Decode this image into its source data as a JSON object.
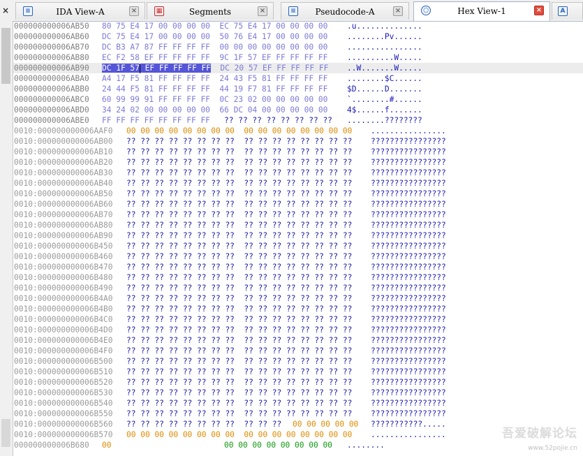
{
  "tabs": [
    {
      "label": "IDA View-A",
      "icon": "listing-icon",
      "active": false
    },
    {
      "label": "Segments",
      "icon": "segments-icon",
      "active": false
    },
    {
      "label": "Pseudocode-A",
      "icon": "pseudocode-icon",
      "active": false
    },
    {
      "label": "Hex View-1",
      "icon": "hex-view-icon",
      "active": true
    },
    {
      "label": "",
      "icon": "structures-icon",
      "active": false
    }
  ],
  "loaded_rows": [
    {
      "addr": "000000000006AB50",
      "bytes": "80 75 E4 17 00 00 00 00  EC 75 E4 17 00 00 00 00",
      "ascii": ".u.............."
    },
    {
      "addr": "000000000006AB60",
      "bytes": "DC 75 E4 17 00 00 00 00  50 76 E4 17 00 00 00 00",
      "ascii": "........Pv......"
    },
    {
      "addr": "000000000006AB70",
      "bytes": "DC B3 A7 87 FF FF FF FF  00 00 00 00 00 00 00 00",
      "ascii": "................"
    },
    {
      "addr": "000000000006AB80",
      "bytes": "EC F2 58 EF FF FF FF FF  9C 1F 57 EF FF FF FF FF",
      "ascii": "..........W....."
    },
    {
      "addr": "000000000006AB90",
      "bytes_pre": "DC 1F 57",
      "bytes_post": " EF FF FF FF FF  DC 20 57 EF FF FF FF FF",
      "ascii": "..W.......W.....",
      "highlight": true
    },
    {
      "addr": "000000000006ABA0",
      "bytes": "A4 17 F5 81 FF FF FF FF  24 43 F5 81 FF FF FF FF",
      "ascii": "........$C......"
    },
    {
      "addr": "000000000006ABB0",
      "bytes": "24 44 F5 81 FF FF FF FF  44 19 F7 81 FF FF FF FF",
      "ascii": "$D......D......."
    },
    {
      "addr": "000000000006ABC0",
      "bytes": "60 99 99 91 FF FF FF FF  0C 23 02 00 00 00 00 00",
      "ascii": "`........#......"
    },
    {
      "addr": "000000000006ABD0",
      "bytes": "34 24 02 00 00 00 00 00  66 DC 04 00 00 00 00 00",
      "ascii": "4$......f......."
    },
    {
      "addr": "000000000006ABE0",
      "bytes": "FF FF FF FF FF FF FF FF",
      "bytes2": "?? ?? ?? ?? ?? ?? ?? ??",
      "ascii": "........????????"
    }
  ],
  "orange_row": {
    "addr": "0010:000000000006AAF0",
    "bytes": "00 00 00 00 00 00 00 00  00 00 00 00 00 00 00 00",
    "ascii": "................"
  },
  "unknown_bytes": "?? ?? ?? ?? ?? ?? ?? ??  ?? ?? ?? ?? ?? ?? ?? ??",
  "unknown_ascii": "????????????????",
  "unknown_rows": [
    "0010:000000000006AB00",
    "0010:000000000006AB10",
    "0010:000000000006AB20",
    "0010:000000000006AB30",
    "0010:000000000006AB40",
    "0010:000000000006AB50",
    "0010:000000000006AB60",
    "0010:000000000006AB70",
    "0010:000000000006AB80",
    "0010:000000000006AB90",
    "0010:000000000006B450",
    "0010:000000000006B460",
    "0010:000000000006B470",
    "0010:000000000006B480",
    "0010:000000000006B490",
    "0010:000000000006B4A0",
    "0010:000000000006B4B0",
    "0010:000000000006B4C0",
    "0010:000000000006B4D0",
    "0010:000000000006B4E0",
    "0010:000000000006B4F0",
    "0010:000000000006B500",
    "0010:000000000006B510",
    "0010:000000000006B520",
    "0010:000000000006B530",
    "0010:000000000006B540",
    "0010:000000000006B550"
  ],
  "mixed_row": {
    "addr": "0010:000000000006B560",
    "bytes": "?? ?? ?? ?? ?? ?? ?? ??  ?? ?? ??",
    "bytes_zero": "00 00 00 00 00",
    "ascii": "???????????....."
  },
  "zero_row": {
    "addr": "0010:000000000006B570",
    "bytes": "00 00 00 00 00 00 00 00  00 00 00 00 00 00 00 00",
    "ascii": "................"
  },
  "last_row": {
    "addr": "000000000006B680",
    "bytes_orange": "00",
    "bytes_green": "00 00 00 00 00 00 00 00",
    "ascii": "........"
  },
  "watermark": {
    "text": "吾爱破解论坛",
    "sub": "www.52pojie.cn"
  },
  "colors": {
    "address": "#808080",
    "bytes_loaded": "#7d7ad8",
    "bytes_unknown": "#1a1aa8",
    "bytes_zero": "#e08a00",
    "selection": "#5555d8",
    "ascii": "#1a1ab8"
  }
}
